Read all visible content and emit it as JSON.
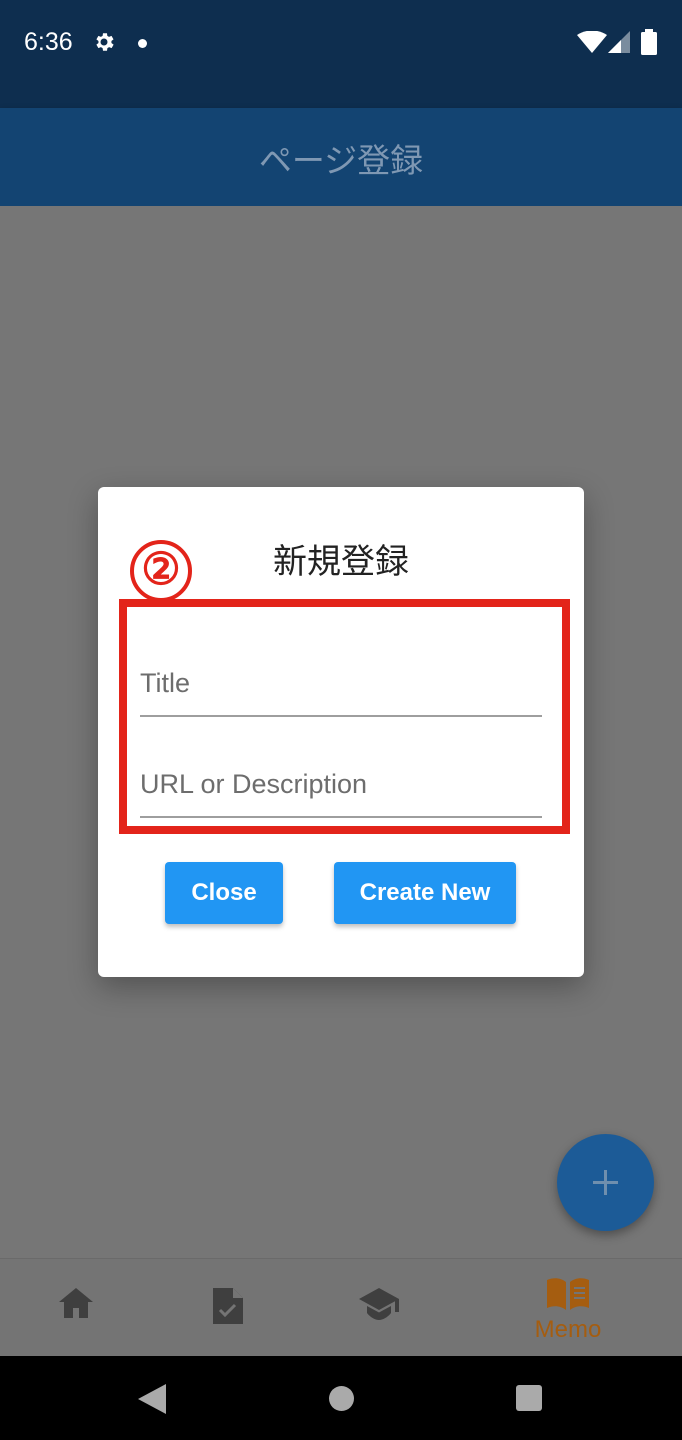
{
  "status_bar": {
    "time": "6:36",
    "icons": [
      "gear-icon",
      "dot-icon",
      "wifi-icon",
      "cell-signal-icon",
      "battery-icon"
    ]
  },
  "app_bar": {
    "title": "ページ登録"
  },
  "dialog": {
    "title": "新規登録",
    "annotation_number": "②",
    "title_field": {
      "placeholder": "Title",
      "value": ""
    },
    "description_field": {
      "placeholder": "URL or Description",
      "value": ""
    },
    "close_label": "Close",
    "create_label": "Create New"
  },
  "fab": {
    "icon": "plus-icon"
  },
  "bottom_nav": {
    "items": [
      {
        "icon": "home-icon",
        "label": ""
      },
      {
        "icon": "document-check-icon",
        "label": ""
      },
      {
        "icon": "school-icon",
        "label": ""
      },
      {
        "icon": "book-icon",
        "label": "Memo"
      }
    ],
    "active_index": 3
  },
  "system_nav": {
    "icons": [
      "back-icon",
      "home-circle-icon",
      "recents-icon"
    ]
  },
  "colors": {
    "status_bar": "#0e2e4f",
    "app_bar": "#134472",
    "scrim": "#767676",
    "primary_button": "#2196f3",
    "annotation_red": "#e3241a",
    "active_nav": "#a55d10"
  }
}
